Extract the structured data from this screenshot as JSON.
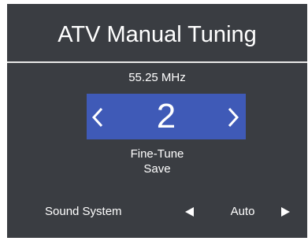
{
  "screen": {
    "title": "ATV Manual Tuning"
  },
  "tuning": {
    "frequency": "55.25 MHz",
    "channel": "2",
    "prev_icon": "chevron-left-icon",
    "next_icon": "chevron-right-icon"
  },
  "menu": {
    "fine_tune_label": "Fine-Tune",
    "save_label": "Save"
  },
  "sound_system": {
    "label": "Sound System",
    "value": "Auto",
    "prev_icon": "triangle-left-icon",
    "next_icon": "triangle-right-icon"
  },
  "colors": {
    "panel_background": "#3a3d42",
    "highlight": "#3f5ab7",
    "text": "#ffffff"
  }
}
